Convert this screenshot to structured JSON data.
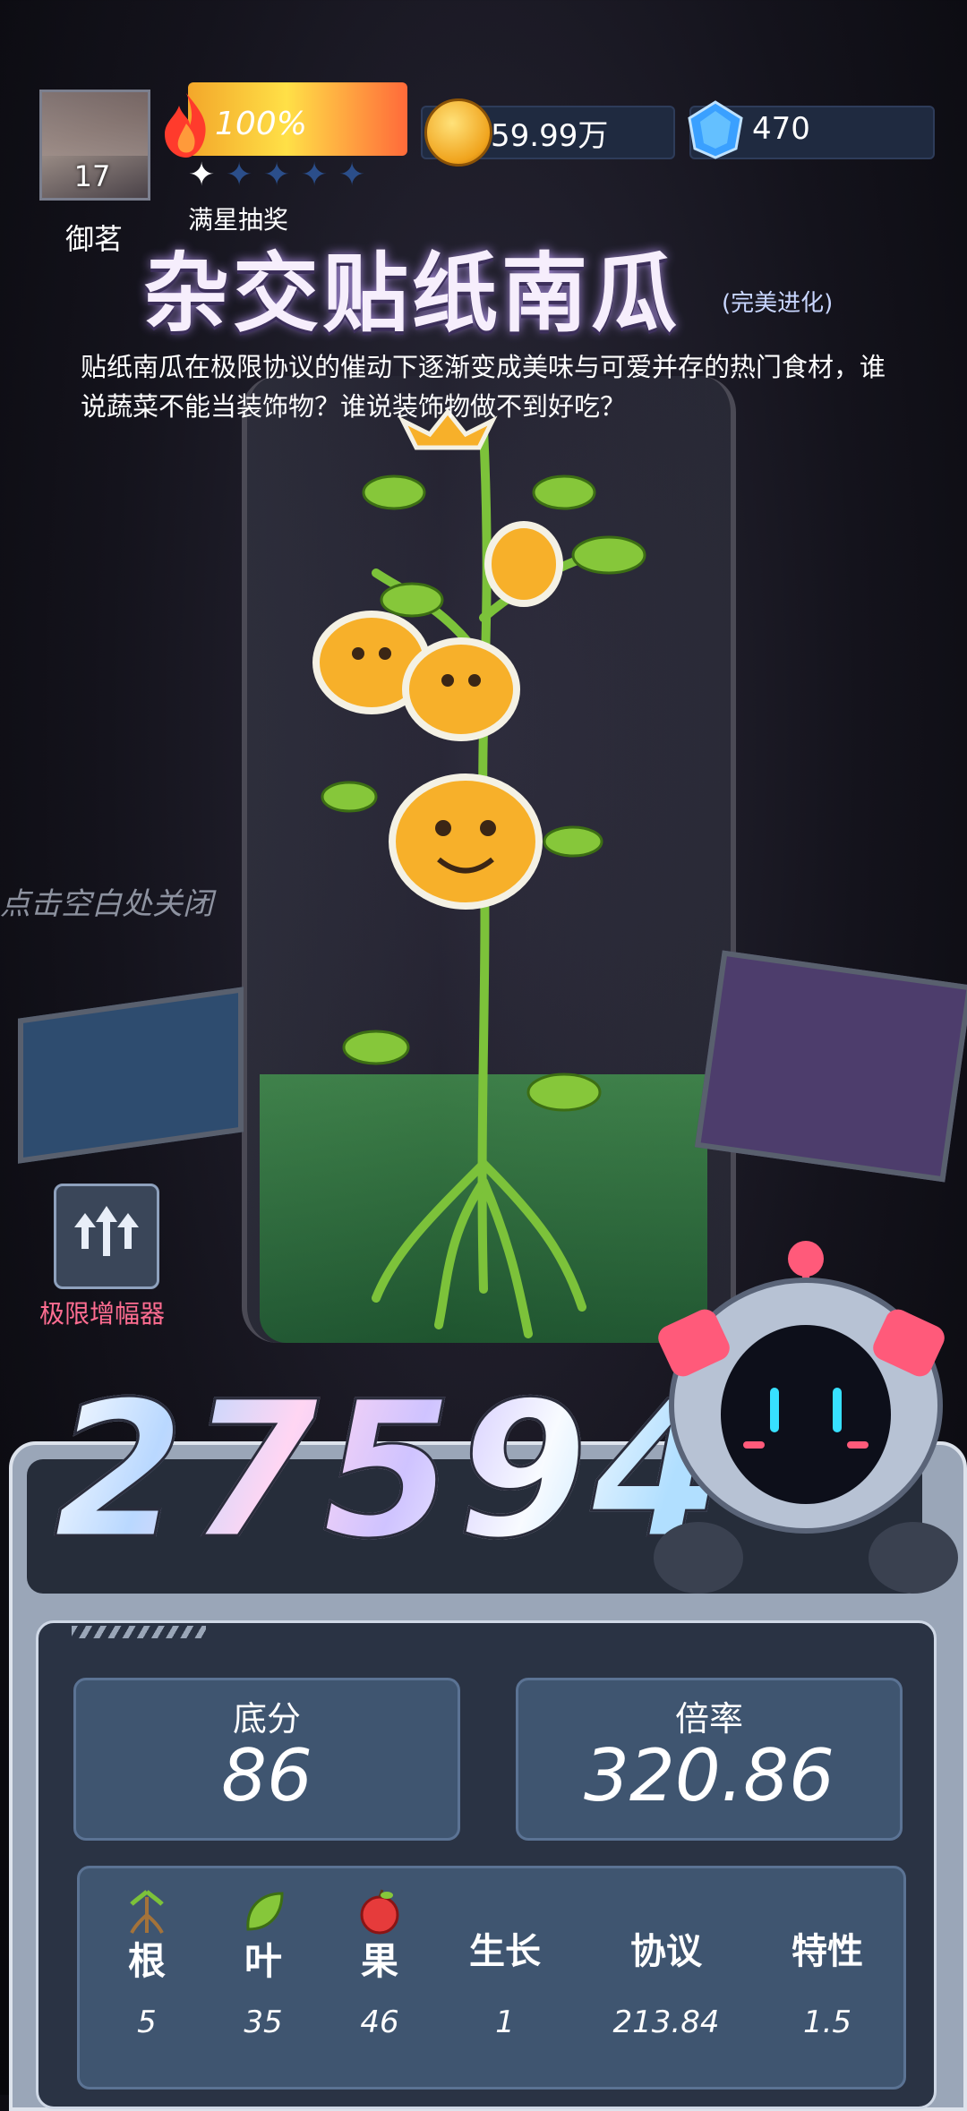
{
  "player": {
    "level": "17",
    "name": "御茗"
  },
  "energy": {
    "percent_label": "100%",
    "stars_filled": 1,
    "stars_total": 5,
    "draw_label": "满星抽奖"
  },
  "currency": {
    "coins": "59.99万",
    "gems": "470"
  },
  "card": {
    "title": "杂交贴纸南瓜",
    "subtitle": "(完美进化)",
    "description": "贴纸南瓜在极限协议的催动下逐渐变成美味与可爱并存的热门食材，谁说蔬菜不能当装饰物？谁说装饰物做不到好吃？"
  },
  "hint": "点击空白处关闭",
  "amplifier_label": "极限增幅器",
  "score": "27594",
  "summary": {
    "base_label": "底分",
    "base_value": "86",
    "mult_label": "倍率",
    "mult_value": "320.86"
  },
  "stats": [
    {
      "label": "根",
      "value": "5",
      "icon": "root-icon"
    },
    {
      "label": "叶",
      "value": "35",
      "icon": "leaf-icon"
    },
    {
      "label": "果",
      "value": "46",
      "icon": "fruit-icon"
    },
    {
      "label": "生长",
      "value": "1"
    },
    {
      "label": "协议",
      "value": "213.84"
    },
    {
      "label": "特性",
      "value": "1.5"
    }
  ],
  "colors": {
    "accent_pink": "#ff6d91",
    "panel_blue": "#3f5570",
    "liquid_green": "#50c85a"
  }
}
